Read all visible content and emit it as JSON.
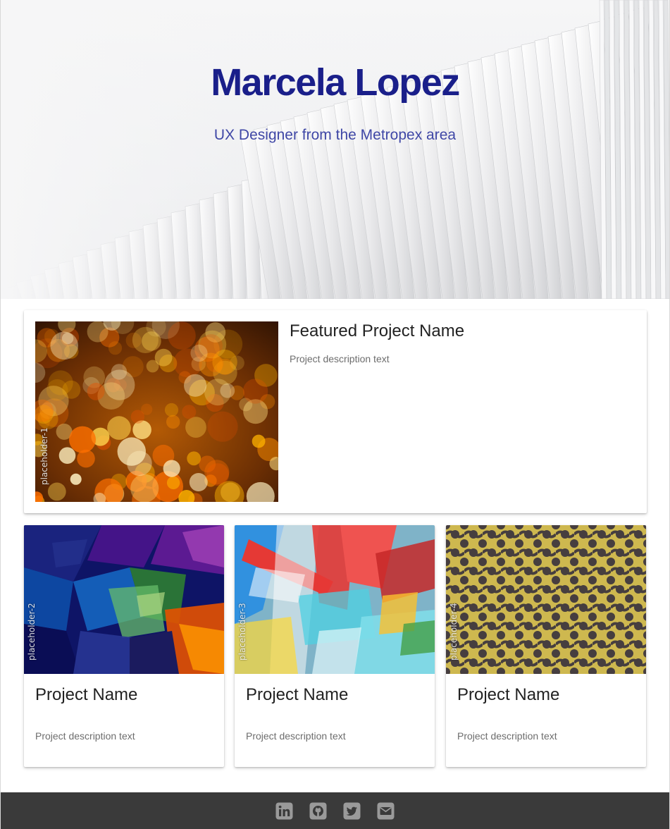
{
  "hero": {
    "title": "Marcela Lopez",
    "subtitle": "UX Designer from the Metropex area",
    "title_color": "#1a1f8a",
    "subtitle_color": "#3f47a6"
  },
  "featured": {
    "title": "Featured Project Name",
    "description": "Project description text",
    "placeholder_label": "placeholder-1"
  },
  "projects": [
    {
      "title": "Project Name",
      "description": "Project description text",
      "placeholder_label": "placeholder-2"
    },
    {
      "title": "Project Name",
      "description": "Project description text",
      "placeholder_label": "placeholder-3"
    },
    {
      "title": "Project Name",
      "description": "Project description text",
      "placeholder_label": "placeholder-4"
    }
  ],
  "footer": {
    "background": "#3a3a3a",
    "icon_color": "#9a9a9a",
    "links": [
      "linkedin-icon",
      "github-icon",
      "twitter-icon",
      "email-icon"
    ]
  }
}
